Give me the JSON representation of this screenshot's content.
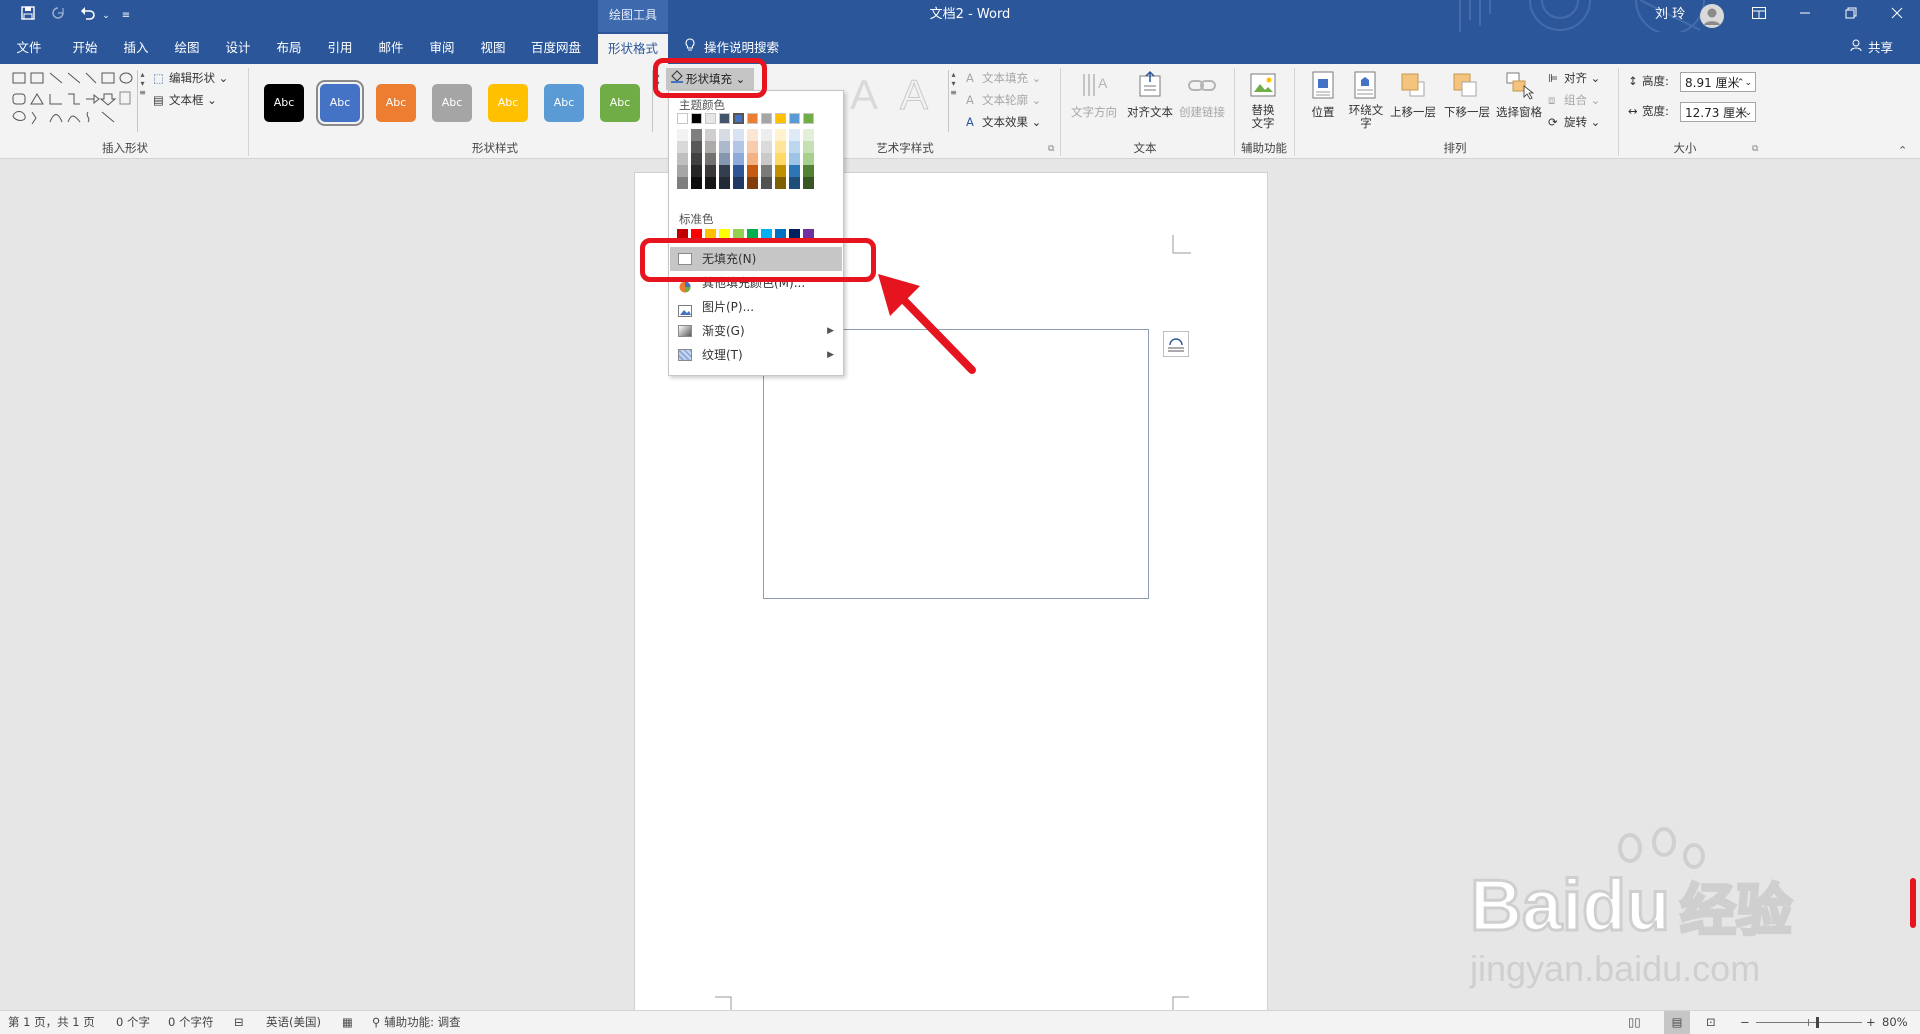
{
  "titlebar": {
    "context_group": "绘图工具",
    "doc_title": "文档2 - Word",
    "user": "刘 玲",
    "qat_customize": "≡"
  },
  "tabs": [
    "文件",
    "开始",
    "插入",
    "绘图",
    "设计",
    "布局",
    "引用",
    "邮件",
    "审阅",
    "视图",
    "百度网盘",
    "形状格式"
  ],
  "active_tab": "形状格式",
  "tell_me": "操作说明搜索",
  "share": "共享",
  "ribbon": {
    "insert_shapes": {
      "label": "插入形状",
      "edit_shape": "编辑形状",
      "text_box": "文本框"
    },
    "shape_styles": {
      "label": "形状样式",
      "swatches": [
        {
          "text": "Abc",
          "color": "#000000"
        },
        {
          "text": "Abc",
          "color": "#4472c4"
        },
        {
          "text": "Abc",
          "color": "#ed7d31"
        },
        {
          "text": "Abc",
          "color": "#a5a5a5"
        },
        {
          "text": "Abc",
          "color": "#ffc000"
        },
        {
          "text": "Abc",
          "color": "#5b9bd5"
        },
        {
          "text": "Abc",
          "color": "#70ad47"
        }
      ],
      "shape_fill": "形状填充"
    },
    "wordart": {
      "label": "艺术字样式",
      "text_fill": "文本填充",
      "text_outline": "文本轮廓",
      "text_effects": "文本效果",
      "letter": "A"
    },
    "text": {
      "label": "文本",
      "direction": "文字方向",
      "align": "对齐文本",
      "link": "创建链接"
    },
    "accessibility": {
      "label": "辅助功能",
      "alt_line1": "替换",
      "alt_line2": "文字"
    },
    "arrange": {
      "label": "排列",
      "position": "位置",
      "wrap_line1": "环绕文",
      "wrap_line2": "字",
      "forward": "上移一层",
      "backward": "下移一层",
      "selection_pane": "选择窗格",
      "align": "对齐",
      "group": "组合",
      "rotate": "旋转"
    },
    "size": {
      "label": "大小",
      "height_label": "高度:",
      "height_value": "8.91 厘米",
      "width_label": "宽度:",
      "width_value": "12.73 厘米"
    }
  },
  "fill_menu": {
    "theme_colors_label": "主题颜色",
    "standard_colors_label": "标准色",
    "theme_top": [
      "#ffffff",
      "#000000",
      "#e7e6e6",
      "#44546a",
      "#4472c4",
      "#ed7d31",
      "#a5a5a5",
      "#ffc000",
      "#5b9bd5",
      "#70ad47"
    ],
    "theme_shades": [
      [
        "#f2f2f2",
        "#d9d9d9",
        "#bfbfbf",
        "#a6a6a6",
        "#7f7f7f"
      ],
      [
        "#7f7f7f",
        "#595959",
        "#404040",
        "#262626",
        "#0d0d0d"
      ],
      [
        "#d0cece",
        "#aeaaaa",
        "#757171",
        "#3a3838",
        "#171616"
      ],
      [
        "#d6dce4",
        "#adb9ca",
        "#8496b0",
        "#333f4f",
        "#222a35"
      ],
      [
        "#d9e2f3",
        "#b4c6e7",
        "#8eaadb",
        "#2f5597",
        "#1f3864"
      ],
      [
        "#fbe5d5",
        "#f7cbac",
        "#f4b183",
        "#c55a11",
        "#833c0b"
      ],
      [
        "#ededed",
        "#dbdbdb",
        "#c9c9c9",
        "#7b7b7b",
        "#525252"
      ],
      [
        "#fff2cc",
        "#fee599",
        "#ffd965",
        "#bf9000",
        "#7f6000"
      ],
      [
        "#deebf6",
        "#bdd7ee",
        "#9dc3e6",
        "#2e75b5",
        "#1f4e79"
      ],
      [
        "#e2efd9",
        "#c5e0b3",
        "#a8d08d",
        "#548235",
        "#375623"
      ]
    ],
    "standard": [
      "#c00000",
      "#ff0000",
      "#ffc000",
      "#ffff00",
      "#92d050",
      "#00b050",
      "#00b0f0",
      "#0070c0",
      "#002060",
      "#7030a0"
    ],
    "items": {
      "no_fill": "无填充(N)",
      "more_colors": "其他填充颜色(M)...",
      "picture": "图片(P)...",
      "gradient": "渐变(G)",
      "texture": "纹理(T)"
    }
  },
  "statusbar": {
    "page": "第 1 页，共 1 页",
    "words": "0 个字",
    "chars": "0 个字符",
    "language": "英语(美国)",
    "accessibility": "辅助功能: 调查",
    "zoom": "80%",
    "zoom_level": 0.58
  },
  "watermark": {
    "brand": "Bai",
    "brand2": "du",
    "cn": "经验",
    "url": "jingyan.baidu.com"
  },
  "colors": {
    "word_blue": "#2b579a",
    "annotation_red": "#e5141f"
  }
}
